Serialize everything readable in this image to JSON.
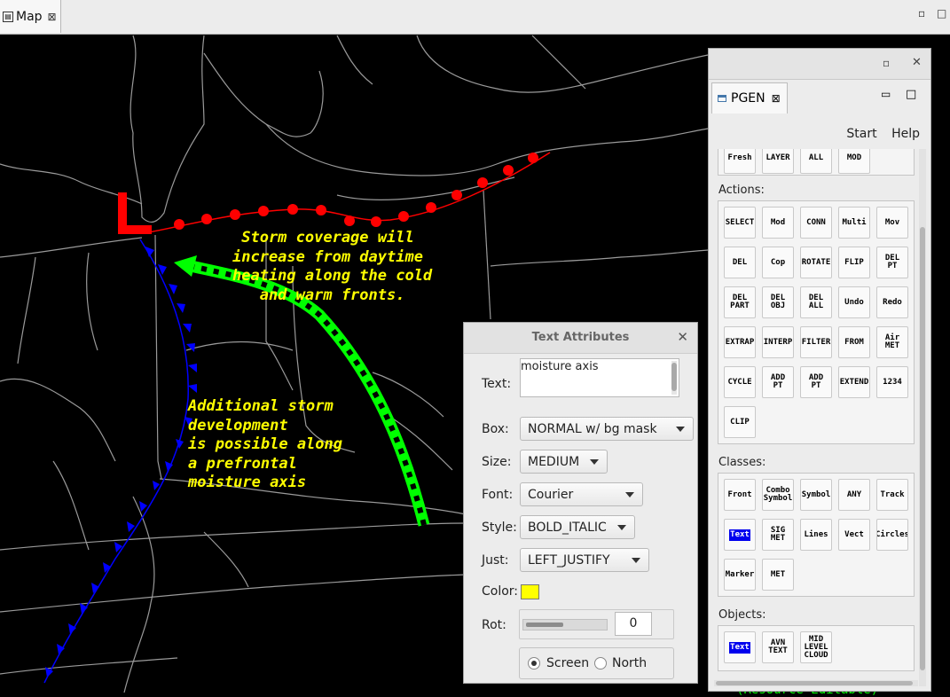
{
  "window": {
    "tab": {
      "label": "Map",
      "icon": "map-icon",
      "close_glyph": "⊠"
    },
    "minimize_glyph": "▫",
    "maximize_glyph": "□"
  },
  "map": {
    "background": "#000000",
    "low_symbol": "L",
    "annotations": [
      {
        "id": "storm-coverage",
        "text": " Storm coverage will\nincrease from daytime\nheating along the cold\n   and warm fronts."
      },
      {
        "id": "additional-storm",
        "text": "Additional storm\ndevelopment\nis possible along\na prefrontal\nmoisture axis"
      }
    ],
    "colors": {
      "warm_front": "#ff0000",
      "cold_front": "#0000ff",
      "moisture_axis": "#00ff00",
      "annotation": "#ffff00",
      "low": "#ff0000",
      "borders": "#9a9a9a"
    },
    "status_fragment": "(Resource Editable)"
  },
  "pgen": {
    "title_buttons": {
      "minimize": "▫",
      "close": "✕"
    },
    "tab": {
      "label": "PGEN",
      "close_glyph": "⊠",
      "min": "▭",
      "max": "□"
    },
    "menu": [
      "Start",
      "Help"
    ],
    "top_row": [
      "Fresh",
      "LAYER",
      "ALL",
      "MOD"
    ],
    "actions_label": "Actions:",
    "actions": [
      "SELECT",
      "Mod",
      "CONN",
      "Multi",
      "Mov",
      "DEL",
      "Cop",
      "ROTATE",
      "FLIP",
      "DEL\nPT",
      "DEL\nPART",
      "DEL\nOBJ",
      "DEL\nALL",
      "Undo",
      "Redo",
      "EXTRAP",
      "INTERP",
      "FILTER",
      "FROM",
      "Air\nMET",
      "CYCLE",
      "ADD\nPT",
      "ADD\nPT",
      "EXTEND",
      "1234"
    ],
    "extra_actions": [
      "CLIP"
    ],
    "classes_label": "Classes:",
    "classes": [
      "Front",
      "Combo\nSymbol",
      "Symbol",
      "ANY",
      "Track",
      "Text",
      "SIG\nMET",
      "Lines",
      "Vect",
      "Circles",
      "Marker",
      "MET"
    ],
    "selected_class": "Text",
    "objects_label": "Objects:",
    "objects": [
      "Text",
      "AVN\nTEXT",
      "MID\nLEVEL\nCLOUD"
    ],
    "selected_object": "Text"
  },
  "text_attributes": {
    "title": "Text Attributes",
    "close_glyph": "✕",
    "text_label": "Text:",
    "text_value": "moisture axis",
    "box_label": "Box:",
    "box_value": "NORMAL w/ bg mask",
    "size_label": "Size:",
    "size_value": "MEDIUM",
    "font_label": "Font:",
    "font_value": "Courier",
    "style_label": "Style:",
    "style_value": "BOLD_ITALIC",
    "just_label": "Just:",
    "just_value": "LEFT_JUSTIFY",
    "color_label": "Color:",
    "color_value": "#ffff00",
    "rot_label": "Rot:",
    "rot_value": "0",
    "rot_slider_fraction": 0.0,
    "screen_label": "Screen",
    "north_label": "North",
    "selected_orientation": "Screen"
  }
}
